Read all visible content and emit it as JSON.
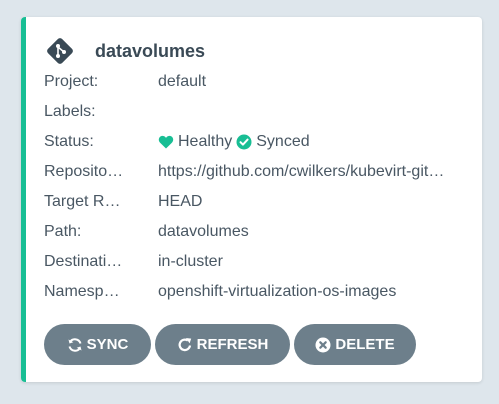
{
  "app": {
    "name": "datavolumes",
    "icon": "git-icon",
    "accent_color": "#18be94"
  },
  "fields": [
    {
      "label": "Project:",
      "value": "default"
    },
    {
      "label": "Labels:",
      "value": ""
    },
    {
      "label": "Status:",
      "health": "Healthy",
      "sync": "Synced",
      "health_icon": "heart-icon",
      "sync_icon": "check-circle-icon",
      "status_color": "#18be94"
    },
    {
      "label": "Reposito…",
      "value": "https://github.com/cwilkers/kubevirt-git…"
    },
    {
      "label": "Target R…",
      "value": "HEAD"
    },
    {
      "label": "Path:",
      "value": "datavolumes"
    },
    {
      "label": "Destinati…",
      "value": "in-cluster"
    },
    {
      "label": "Namesp…",
      "value": "openshift-virtualization-os-images"
    }
  ],
  "buttons": {
    "sync": {
      "label": "SYNC",
      "icon": "sync-icon"
    },
    "refresh": {
      "label": "REFRESH",
      "icon": "refresh-icon"
    },
    "delete": {
      "label": "DELETE",
      "icon": "times-circle-icon"
    }
  }
}
